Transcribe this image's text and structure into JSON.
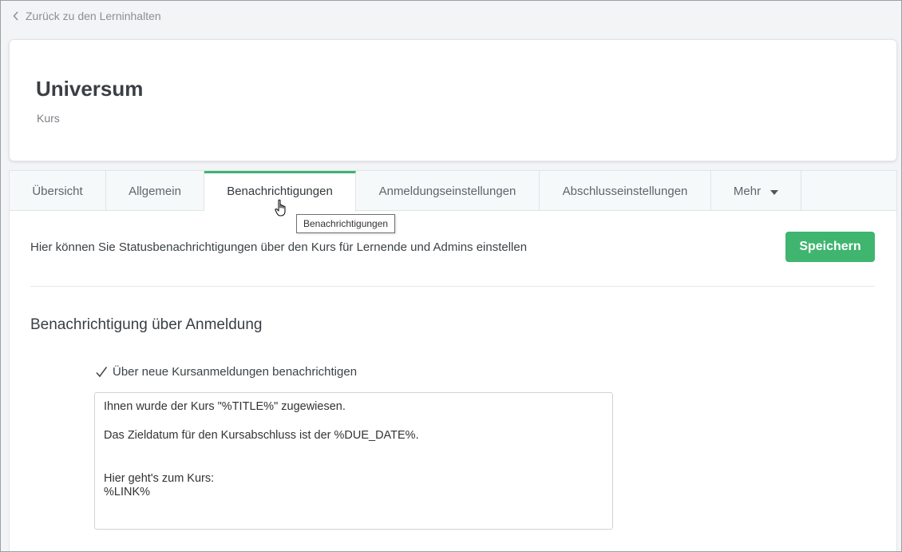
{
  "back_link": {
    "label": "Zurück zu den Lerninhalten",
    "icon": "chevron-left-icon"
  },
  "header": {
    "title": "Universum",
    "subtitle": "Kurs"
  },
  "tabs": [
    {
      "label": "Übersicht",
      "active": false
    },
    {
      "label": "Allgemein",
      "active": false
    },
    {
      "label": "Benachrichtigungen",
      "active": true
    },
    {
      "label": "Anmeldungseinstellungen",
      "active": false
    },
    {
      "label": "Abschlusseinstellungen",
      "active": false
    },
    {
      "label": "Mehr",
      "active": false,
      "icon": "caret-down-icon"
    }
  ],
  "tooltip": "Benachrichtigungen",
  "main": {
    "intro": "Hier können Sie Statusbenachrichtigungen über den Kurs für Lernende und Admins einstellen",
    "save_label": "Speichern",
    "section_heading": "Benachrichtigung über Anmeldung",
    "checkbox": {
      "label": "Über neue Kursanmeldungen benachrichtigen",
      "checked": true
    },
    "message": {
      "line1": "Ihnen wurde der Kurs \"%TITLE%\" zugewiesen.",
      "line2": "Das Zieldatum für den Kursabschluss ist der %DUE_DATE%.",
      "line3": "Hier geht's zum Kurs:",
      "line4": "%LINK%"
    }
  },
  "colors": {
    "accent": "#3fb373",
    "save_button": "#3fb56f",
    "background": "#f3f4f6"
  }
}
